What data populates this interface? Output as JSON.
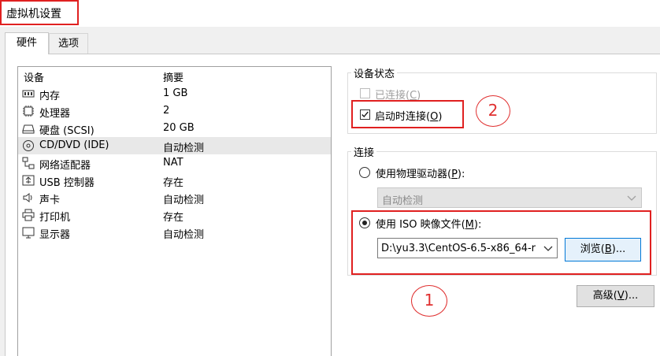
{
  "window": {
    "title": "虚拟机设置"
  },
  "tabs": [
    {
      "label": "硬件"
    },
    {
      "label": "选项"
    }
  ],
  "device_list": {
    "col_device": "设备",
    "col_summary": "摘要",
    "rows": [
      {
        "name": "内存",
        "summary": "1 GB",
        "icon": "memory-icon"
      },
      {
        "name": "处理器",
        "summary": "2",
        "icon": "cpu-icon"
      },
      {
        "name": "硬盘 (SCSI)",
        "summary": "20 GB",
        "icon": "harddisk-icon"
      },
      {
        "name": "CD/DVD (IDE)",
        "summary": "自动检测",
        "icon": "cd-dvd-icon",
        "selected": true
      },
      {
        "name": "网络适配器",
        "summary": "NAT",
        "icon": "network-icon"
      },
      {
        "name": "USB 控制器",
        "summary": "存在",
        "icon": "usb-icon"
      },
      {
        "name": "声卡",
        "summary": "自动检测",
        "icon": "speaker-icon"
      },
      {
        "name": "打印机",
        "summary": "存在",
        "icon": "printer-icon"
      },
      {
        "name": "显示器",
        "summary": "自动检测",
        "icon": "monitor-icon"
      }
    ]
  },
  "device_status": {
    "title": "设备状态",
    "connected": {
      "label": "已连接(",
      "key": "C",
      "end": ")",
      "checked": false,
      "disabled": true
    },
    "connect_on_start": {
      "label": "启动时连接(",
      "key": "O",
      "end": ")",
      "checked": true
    }
  },
  "connection": {
    "title": "连接",
    "physical": {
      "label": "使用物理驱动器(",
      "key": "P",
      "end": "):",
      "selected": false
    },
    "physical_select": "自动检测",
    "iso": {
      "label": "使用 ISO 映像文件(",
      "key": "M",
      "end": "):",
      "selected": true
    },
    "iso_path": "D:\\yu3.3\\CentOS-6.5-x86_64-r",
    "browse": {
      "label": "浏览(",
      "key": "B",
      "end": ")..."
    }
  },
  "advanced": {
    "label": "高级(",
    "key": "V",
    "end": ")..."
  },
  "annotations": [
    {
      "text": "1"
    },
    {
      "text": "2"
    }
  ],
  "colors": {
    "annotation_red": "#e02020",
    "focus_blue": "#0078d7"
  }
}
